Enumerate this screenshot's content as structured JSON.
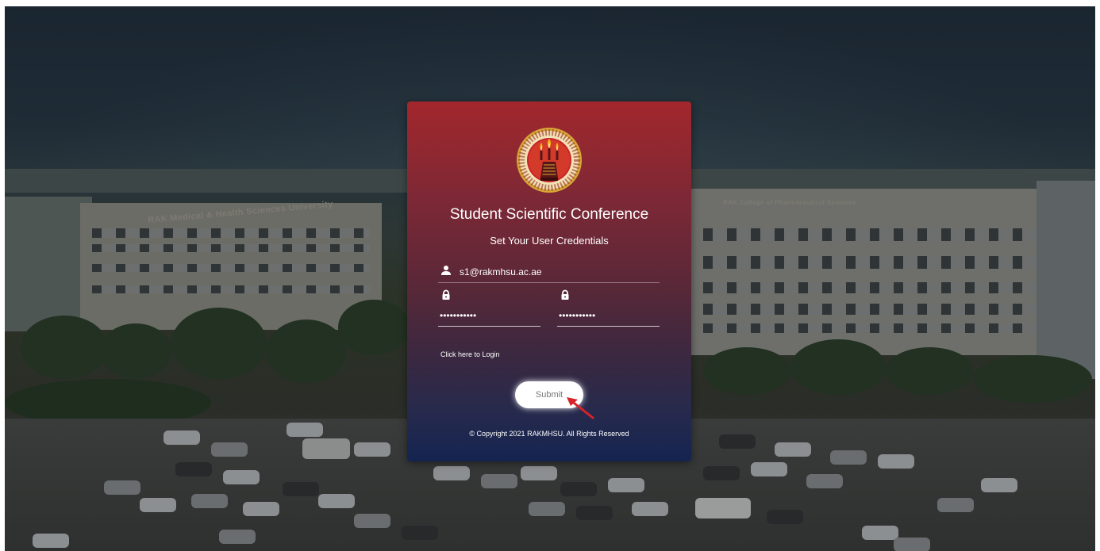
{
  "app": {
    "title": "Student Scientific Conference",
    "subtitle": "Set Your User Credentials"
  },
  "background": {
    "sign_left": "RAK Medical & Health Sciences University",
    "sign_right": "RAK College of Pharmaceutical Sciences"
  },
  "form": {
    "email_value": "s1@rakmhsu.ac.ae",
    "email_icon": "user-icon",
    "password_value": "abcdefghijk",
    "password_icon": "lock-icon",
    "confirm_password_value": "abcdefghijk",
    "confirm_password_icon": "lock-icon",
    "login_link_label": "Click here to Login",
    "submit_label": "Submit"
  },
  "footer": {
    "copyright": "© Copyright 2021 RAKMHSU. All Rights Reserved"
  },
  "colors": {
    "card_top": "#a2272c",
    "card_bottom": "#142451",
    "button_bg": "#ffffff",
    "cursor_arrow": "#d8222a"
  }
}
